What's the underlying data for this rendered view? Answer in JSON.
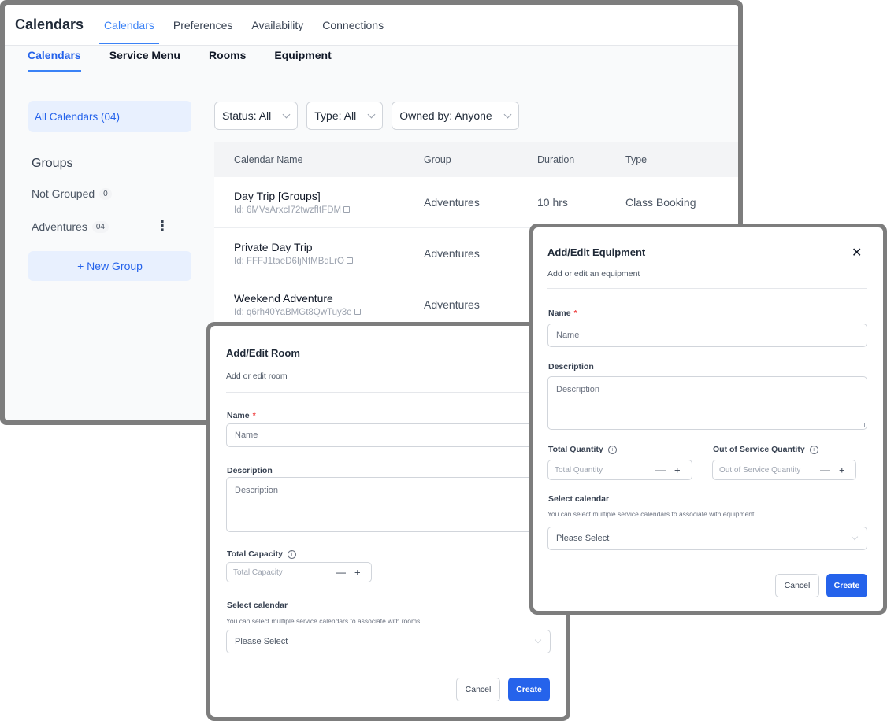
{
  "app": {
    "title": "Calendars"
  },
  "top_tabs": [
    {
      "label": "Calendars",
      "active": true
    },
    {
      "label": "Preferences",
      "active": false
    },
    {
      "label": "Availability",
      "active": false
    },
    {
      "label": "Connections",
      "active": false
    }
  ],
  "sub_tabs": [
    {
      "label": "Calendars",
      "active": true
    },
    {
      "label": "Service Menu",
      "active": false
    },
    {
      "label": "Rooms",
      "active": false
    },
    {
      "label": "Equipment",
      "active": false
    }
  ],
  "sidebar": {
    "all_calendars": "All Calendars (04)",
    "groups_title": "Groups",
    "groups": [
      {
        "label": "Not Grouped",
        "count": "0"
      },
      {
        "label": "Adventures",
        "count": "04"
      }
    ],
    "kebab": "⋮",
    "new_group": "+ New Group"
  },
  "filters": {
    "status": "Status: All",
    "type": "Type: All",
    "owned_by": "Owned by: Anyone"
  },
  "table": {
    "headers": [
      "Calendar Name",
      "Group",
      "Duration",
      "Type"
    ],
    "rows": [
      {
        "name": "Day Trip [Groups]",
        "id": "Id: 6MVsArxcI72twzfItFDM",
        "group": "Adventures",
        "duration": "10 hrs",
        "type": "Class Booking"
      },
      {
        "name": "Private Day Trip",
        "id": "Id: FFFJ1taeD6IjNfMBdLrO",
        "group": "Adventures",
        "duration": "",
        "type": ""
      },
      {
        "name": "Weekend Adventure",
        "id": "Id: q6rh40YaBMGt8QwTuy3e",
        "group": "Adventures",
        "duration": "",
        "type": ""
      }
    ]
  },
  "room_modal": {
    "title": "Add/Edit Room",
    "subtitle": "Add or edit room",
    "name_label": "Name",
    "required": "*",
    "name_placeholder": "Name",
    "description_label": "Description",
    "description_placeholder": "Description",
    "capacity_label": "Total Capacity",
    "capacity_placeholder": "Total Capacity",
    "minus": "—",
    "plus": "+",
    "select_label": "Select calendar",
    "select_hint": "You can select multiple service calendars to associate with rooms",
    "select_value": "Please Select",
    "cancel": "Cancel",
    "create": "Create"
  },
  "equipment_modal": {
    "title": "Add/Edit Equipment",
    "subtitle": "Add or edit an equipment",
    "close": "✕",
    "name_label": "Name",
    "required": "*",
    "name_placeholder": "Name",
    "description_label": "Description",
    "description_placeholder": "Description",
    "total_qty_label": "Total Quantity",
    "total_qty_placeholder": "Total Quantity",
    "oos_qty_label": "Out of Service Quantity",
    "oos_qty_placeholder": "Out of Service Quantity",
    "minus": "—",
    "plus": "+",
    "select_label": "Select calendar",
    "select_hint": "You can select multiple service calendars to associate with equipment",
    "select_value": "Please Select",
    "cancel": "Cancel",
    "create": "Create"
  },
  "colors": {
    "accent": "#2563eb",
    "tab_active": "#3b82f6",
    "frame": "#7d7d7d"
  },
  "icons": [
    "chevron-down-icon",
    "copy-icon",
    "info-icon",
    "close-icon",
    "kebab-menu-icon",
    "plus-icon",
    "minus-icon"
  ]
}
